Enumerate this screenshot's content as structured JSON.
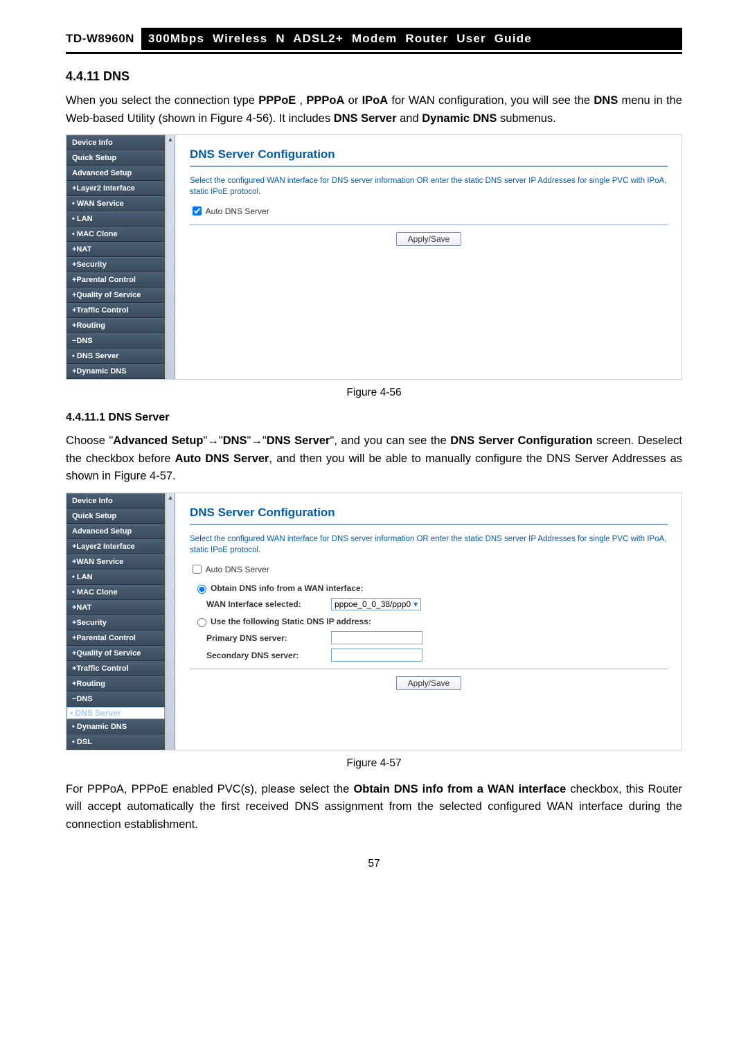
{
  "header": {
    "model": "TD-W8960N",
    "title": "300Mbps Wireless N ADSL2+ Modem Router User Guide"
  },
  "section": {
    "num_title": "4.4.11 DNS",
    "intro_pre": "When you select the connection type ",
    "p1_b1": "PPPoE",
    "p1_c1": ", ",
    "p1_b2": "PPPoA",
    "p1_c2": " or ",
    "p1_b3": "IPoA",
    "p1_c3": " for WAN configuration, you will see the ",
    "p1_b4": "DNS",
    "p1_c4": " menu in the Web-based Utility (shown in Figure 4-56). It includes ",
    "p1_b5": "DNS Server",
    "p1_c5": " and ",
    "p1_b6": "Dynamic DNS",
    "p1_c6": " submenus."
  },
  "fig56": {
    "caption": "Figure 4-56",
    "conf_title": "DNS Server Configuration",
    "desc": "Select the configured WAN interface for DNS server information OR enter the static DNS server IP Addresses for single PVC with IPoA, static IPoE protocol.",
    "auto_dns_label": "Auto DNS Server",
    "apply": "Apply/Save",
    "nav": [
      "Device Info",
      "Quick Setup",
      "Advanced Setup",
      "+Layer2 Interface",
      "• WAN Service",
      "• LAN",
      "• MAC Clone",
      "+NAT",
      "+Security",
      "+Parental Control",
      "+Quality of Service",
      "+Traffic Control",
      "+Routing",
      "−DNS",
      "• DNS Server",
      "+Dynamic DNS"
    ]
  },
  "sub": {
    "num_title": "4.4.11.1 DNS Server",
    "p_pre": "Choose \"",
    "p_b1": "Advanced Setup",
    "p_mid1": "\"→\"",
    "p_b2": "DNS",
    "p_mid2": "\"→\"",
    "p_b3": "DNS Server",
    "p_mid3": "\", and you can see the ",
    "p_b4": "DNS Server Configuration",
    "p_mid4": " screen. Deselect the checkbox before ",
    "p_b5": "Auto DNS Server",
    "p_mid5": ", and then you will be able to manually configure the DNS Server Addresses as shown in Figure 4-57."
  },
  "fig57": {
    "caption": "Figure 4-57",
    "conf_title": "DNS Server Configuration",
    "desc": "Select the configured WAN interface for DNS server information OR enter the static DNS server IP Addresses for single PVC with IPoA, static IPoE protocol.",
    "auto_dns_label": "Auto DNS Server",
    "opt1": "Obtain DNS info from a WAN interface:",
    "wan_if_label": "WAN Interface selected:",
    "wan_if_value": "pppoe_0_0_38/ppp0",
    "opt2": "Use the following Static DNS IP address:",
    "primary_label": "Primary DNS server:",
    "secondary_label": "Secondary DNS server:",
    "apply": "Apply/Save",
    "nav": [
      "Device Info",
      "Quick Setup",
      "Advanced Setup",
      "+Layer2 Interface",
      "+WAN Service",
      "• LAN",
      "• MAC Clone",
      "+NAT",
      "+Security",
      "+Parental Control",
      "+Quality of Service",
      "+Traffic Control",
      "+Routing",
      "−DNS",
      "• DNS Server",
      "• Dynamic DNS",
      "• DSL"
    ]
  },
  "tail": {
    "p_pre": "For PPPoA, PPPoE enabled PVC(s), please select the ",
    "p_b1": "Obtain DNS info from a WAN interface",
    "p_rest": " checkbox, this Router will accept automatically the first received DNS assignment from the selected configured WAN interface during the connection establishment."
  },
  "page_number": "57"
}
